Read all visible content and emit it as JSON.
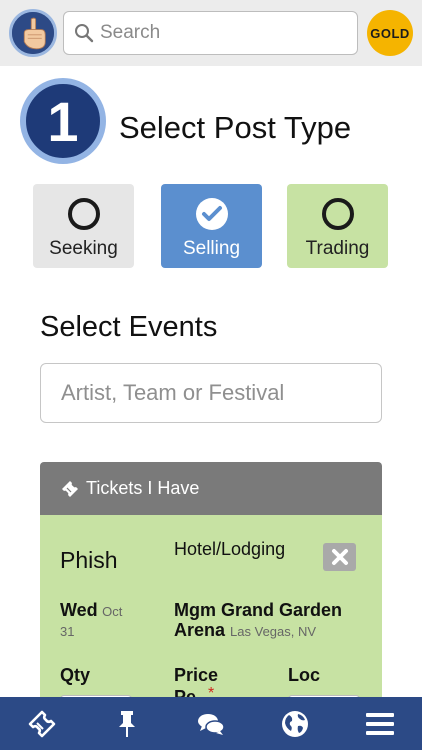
{
  "header": {
    "search_placeholder": "Search",
    "badge_label": "GOLD"
  },
  "step": {
    "number": "1",
    "title": "Select Post Type"
  },
  "post_types": [
    {
      "label": "Seeking",
      "selected": false
    },
    {
      "label": "Selling",
      "selected": true
    },
    {
      "label": "Trading",
      "selected": false
    }
  ],
  "events": {
    "title": "Select Events",
    "input_placeholder": "Artist, Team or Festival"
  },
  "tickets_card": {
    "header_label": "Tickets I Have",
    "artist": "Phish",
    "category": "Hotel/Lodging",
    "date_dow": "Wed",
    "date_month": "Oct",
    "date_day": "31",
    "venue": "Mgm Grand Garden Arena",
    "venue_location": "Las Vegas, NV",
    "col_qty": "Qty",
    "col_price": "Price",
    "col_loc": "Loc",
    "price_sub": "Pe",
    "required_mark": "*"
  },
  "colors": {
    "accent_blue": "#2c4a86",
    "selling_blue": "#5b8fcf",
    "trading_green": "#c7e2a3",
    "gold": "#f5b400"
  },
  "icons": {
    "avatar": "pointing-finger-icon",
    "search": "search-icon",
    "bottom_nav": [
      "ticket-icon",
      "pin-icon",
      "chat-icon",
      "globe-icon",
      "menu-icon"
    ]
  }
}
